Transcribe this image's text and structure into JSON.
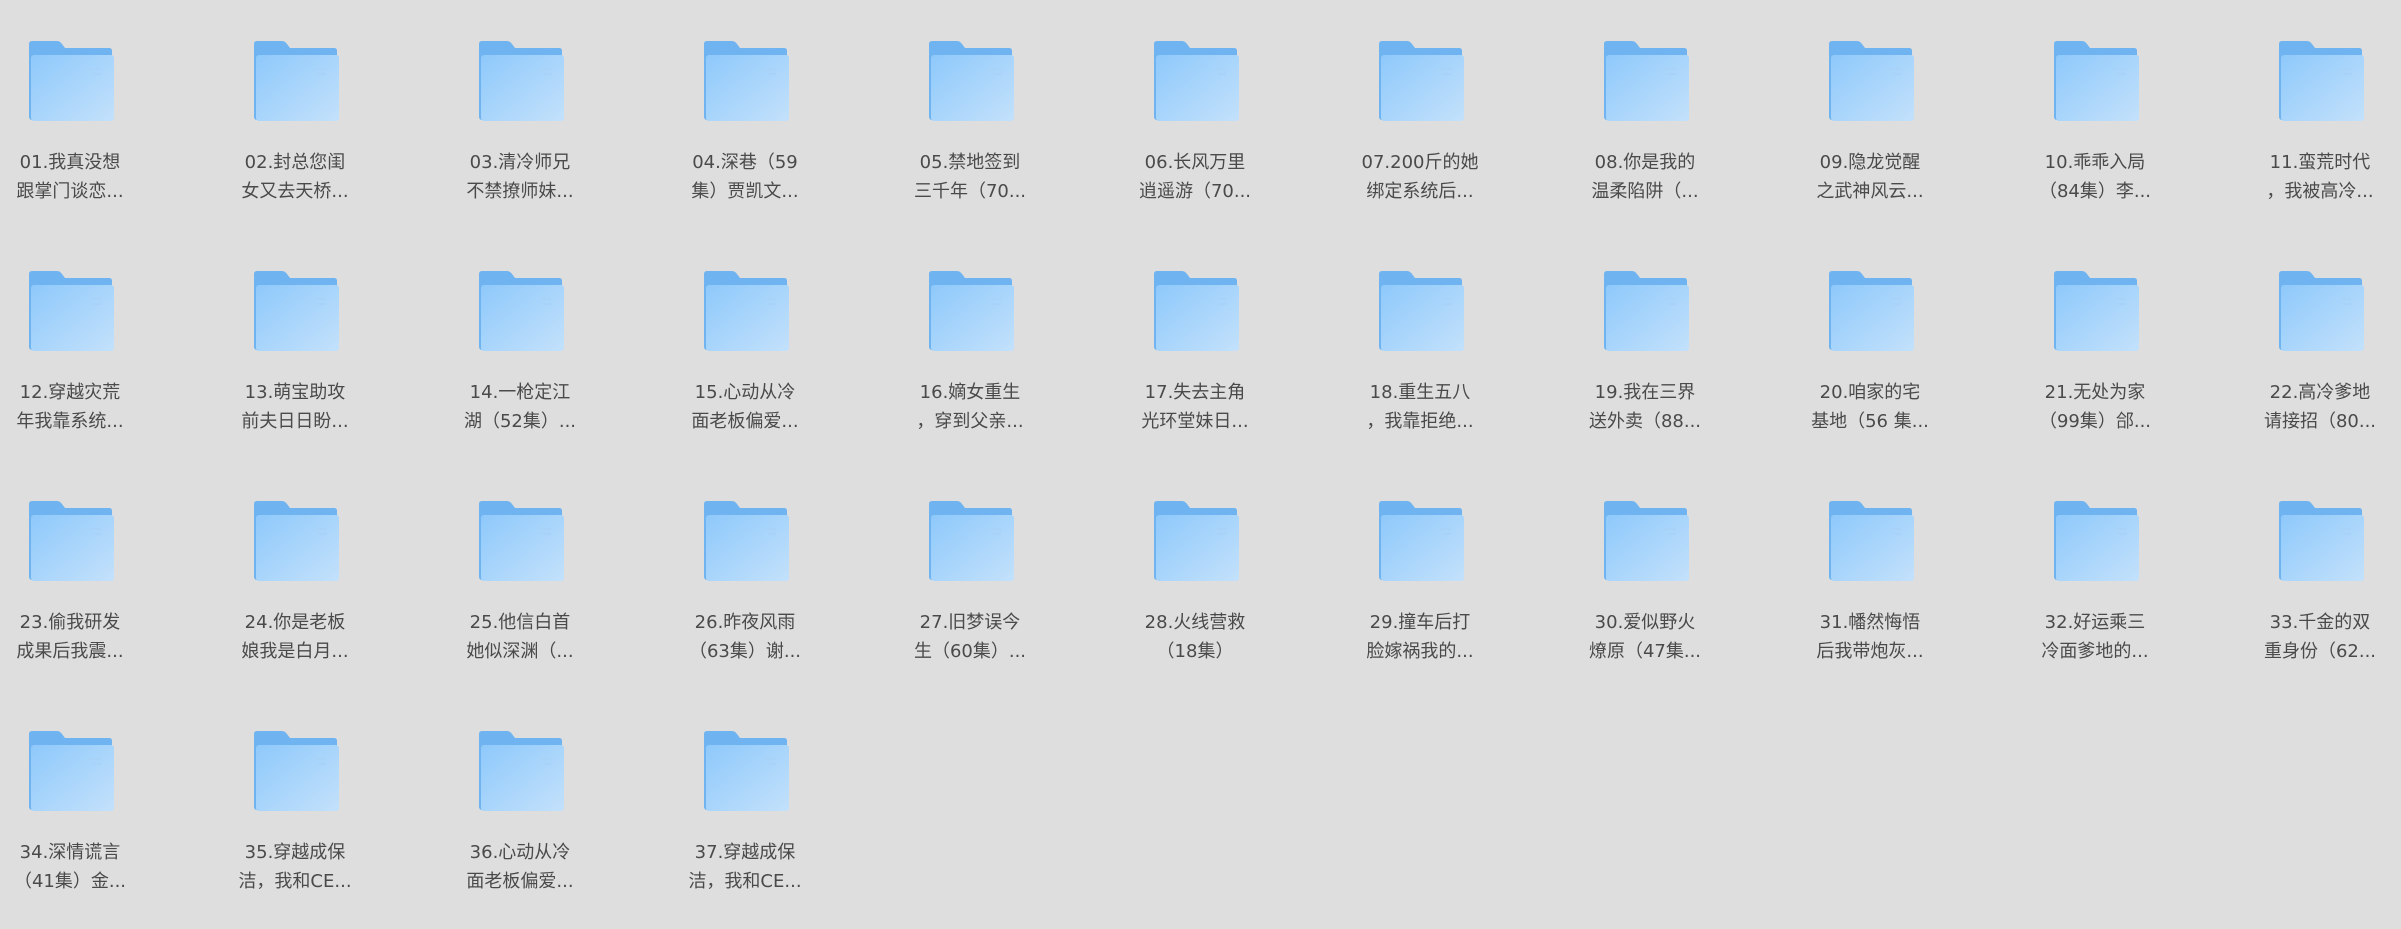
{
  "view": "file-explorer-large-icons",
  "icon": "folder-icon",
  "colors": {
    "background": "#dedede",
    "label_text": "#4a4a4a",
    "folder_back": "#6fb3f0",
    "folder_front_top": "#8ec9fb",
    "folder_front_bottom": "#c3e1fb"
  },
  "folders": [
    {
      "line1": "01.我真没想",
      "line2": "跟掌门谈恋..."
    },
    {
      "line1": "02.封总您闺",
      "line2": "女又去天桥..."
    },
    {
      "line1": "03.清冷师兄",
      "line2": "不禁撩师妹..."
    },
    {
      "line1": "04.深巷（59",
      "line2": "集）贾凯文..."
    },
    {
      "line1": "05.禁地签到",
      "line2": "三千年（70..."
    },
    {
      "line1": "06.长风万里",
      "line2": "逍遥游（70..."
    },
    {
      "line1": "07.200斤的她",
      "line2": "绑定系统后..."
    },
    {
      "line1": "08.你是我的",
      "line2": "温柔陷阱（..."
    },
    {
      "line1": "09.隐龙觉醒",
      "line2": "之武神风云..."
    },
    {
      "line1": "10.乖乖入局",
      "line2": "（84集）李..."
    },
    {
      "line1": "11.蛮荒时代",
      "line2": "，我被高冷..."
    },
    {
      "line1": "12.穿越灾荒",
      "line2": "年我靠系统..."
    },
    {
      "line1": "13.萌宝助攻",
      "line2": "前夫日日盼..."
    },
    {
      "line1": "14.一枪定江",
      "line2": "湖（52集）..."
    },
    {
      "line1": "15.心动从冷",
      "line2": "面老板偏爱..."
    },
    {
      "line1": "16.嫡女重生",
      "line2": "，穿到父亲..."
    },
    {
      "line1": "17.失去主角",
      "line2": "光环堂妹日..."
    },
    {
      "line1": "18.重生五八",
      "line2": "，我靠拒绝..."
    },
    {
      "line1": "19.我在三界",
      "line2": "送外卖（88..."
    },
    {
      "line1": "20.咱家的宅",
      "line2": "基地（56 集..."
    },
    {
      "line1": "21.无处为家",
      "line2": "（99集）郃..."
    },
    {
      "line1": "22.高冷爹地",
      "line2": "请接招（80..."
    },
    {
      "line1": "23.偷我研发",
      "line2": "成果后我震..."
    },
    {
      "line1": "24.你是老板",
      "line2": "娘我是白月..."
    },
    {
      "line1": "25.他信白首",
      "line2": "她似深渊（..."
    },
    {
      "line1": "26.昨夜风雨",
      "line2": "（63集）谢..."
    },
    {
      "line1": "27.旧梦误今",
      "line2": "生（60集）..."
    },
    {
      "line1": "28.火线营救",
      "line2": "（18集）"
    },
    {
      "line1": "29.撞车后打",
      "line2": "脸嫁祸我的..."
    },
    {
      "line1": "30.爱似野火",
      "line2": "燎原（47集..."
    },
    {
      "line1": "31.幡然悔悟",
      "line2": "后我带炮灰..."
    },
    {
      "line1": "32.好运乘三",
      "line2": "冷面爹地的..."
    },
    {
      "line1": "33.千金的双",
      "line2": "重身份（62..."
    },
    {
      "line1": "34.深情谎言",
      "line2": "（41集）金..."
    },
    {
      "line1": "35.穿越成保",
      "line2": "洁，我和CE..."
    },
    {
      "line1": "36.心动从冷",
      "line2": "面老板偏爱..."
    },
    {
      "line1": "37.穿越成保",
      "line2": "洁，我和CE..."
    }
  ]
}
